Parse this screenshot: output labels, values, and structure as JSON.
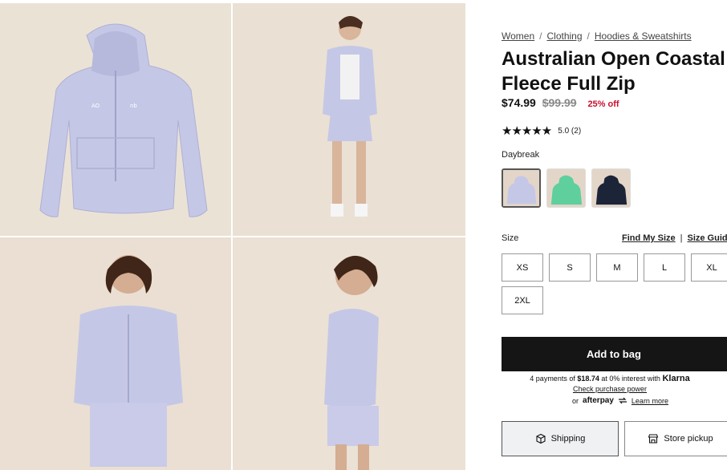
{
  "breadcrumb": {
    "items": [
      "Women",
      "Clothing",
      "Hoodies & Sweatshirts"
    ],
    "separator": "/"
  },
  "product": {
    "title": "Australian Open Coastal Fleece Full Zip",
    "price": "$74.99",
    "original_price": "$99.99",
    "discount": "25% off",
    "rating_stars": "★★★★★",
    "rating_text": "5.0 (2)"
  },
  "color": {
    "label": "Daybreak",
    "swatches": [
      {
        "name": "lavender",
        "hex": "#c5c7e6",
        "selected": true
      },
      {
        "name": "green",
        "hex": "#5fcf9d",
        "selected": false
      },
      {
        "name": "navy",
        "hex": "#1c2438",
        "selected": false
      }
    ]
  },
  "size": {
    "label": "Size",
    "find_my_size": "Find My Size",
    "divider": "|",
    "size_guide": "Size Guid",
    "options": [
      "XS",
      "S",
      "M",
      "L",
      "XL",
      "2XL"
    ]
  },
  "cart": {
    "add_to_bag": "Add to bag"
  },
  "klarna": {
    "prefix": "4 payments of",
    "amount": "$18.74",
    "middle": "at 0% interest with",
    "brand": "Klarna",
    "check_link": "Check purchase power"
  },
  "afterpay": {
    "or": "or",
    "brand": "afterpay",
    "learn_more": "Learn more"
  },
  "fulfillment": {
    "shipping": "Shipping",
    "store_pickup": "Store pickup"
  },
  "colors": {
    "hoodie": "#c5c7e6",
    "background": "#e9ddd0",
    "sale_red": "#c8102e",
    "button_dark": "#151515"
  }
}
